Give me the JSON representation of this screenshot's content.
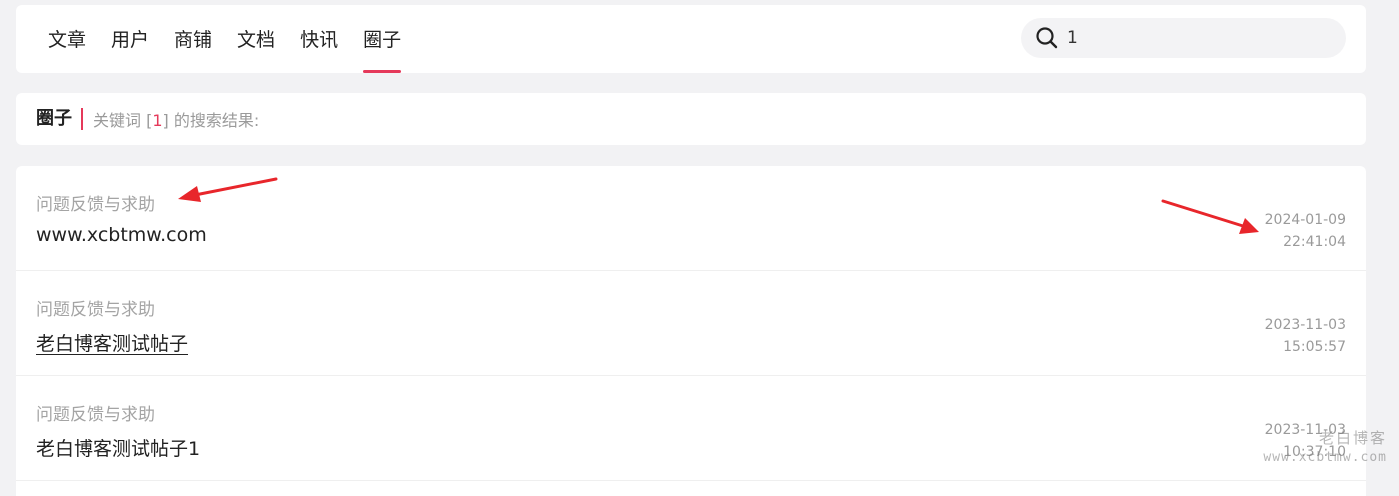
{
  "nav": {
    "tabs": [
      {
        "label": "文章"
      },
      {
        "label": "用户"
      },
      {
        "label": "商铺"
      },
      {
        "label": "文档"
      },
      {
        "label": "快讯"
      },
      {
        "label": "圈子"
      }
    ],
    "active_tab": "圈子",
    "search_value": "1"
  },
  "result_header": {
    "title": "圈子",
    "prefix": "关键词 [",
    "keyword": "1",
    "suffix": "] 的搜索结果:"
  },
  "results": [
    {
      "category": "问题反馈与求助",
      "title": "www.xcbtmw.com",
      "date": "2024-01-09",
      "time": "22:41:04"
    },
    {
      "category": "问题反馈与求助",
      "title": "老白博客测试帖子",
      "date": "2023-11-03",
      "time": "15:05:57"
    },
    {
      "category": "问题反馈与求助",
      "title": "老白博客测试帖子1",
      "date": "2023-11-03",
      "time": "10:37:10"
    }
  ],
  "watermark": {
    "name": "老白博客",
    "url": "www.xcbtmw.com"
  },
  "colors": {
    "accent": "#e5395a",
    "annotation_arrow": "#e8262b"
  }
}
